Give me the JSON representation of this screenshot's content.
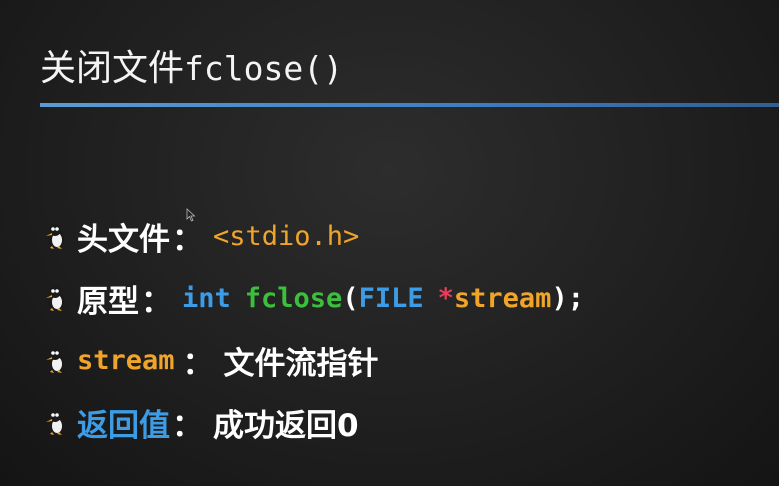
{
  "slide": {
    "title_cn": "关闭文件",
    "title_code": "fclose()",
    "accent_color": "#5b9bd5"
  },
  "bullets": [
    {
      "label": "头文件",
      "colon": "：",
      "value": "<stdio.h>"
    },
    {
      "label": "原型",
      "colon": "：",
      "code_int": "int",
      "code_fn": "fclose",
      "code_open": "(",
      "code_type": "FILE",
      "code_star": "*",
      "code_param": "stream",
      "code_close": ");"
    },
    {
      "label": "stream",
      "colon": "：",
      "value": "文件流指针"
    },
    {
      "label": "返回值",
      "colon": "：",
      "value": "成功返回0"
    }
  ],
  "colors": {
    "keyword": "#3c9ce6",
    "function": "#3cbf3c",
    "identifier": "#f0a52a",
    "pointer": "#e83c5a"
  },
  "icons": [
    "penguin-bullet-icon",
    "mouse-cursor-icon"
  ]
}
